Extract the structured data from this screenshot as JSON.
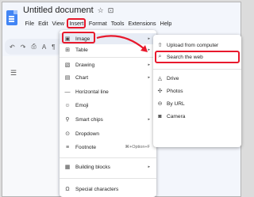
{
  "header": {
    "doc_title": "Untitled document",
    "star_icon": "star-icon",
    "folder_icon": "folder-icon"
  },
  "menubar": [
    "File",
    "Edit",
    "View",
    "Insert",
    "Format",
    "Tools",
    "Extensions",
    "Help"
  ],
  "active_menu": "Insert",
  "toolbar": {
    "undo": "↶",
    "redo": "↷",
    "print": "⎙",
    "spellcheck": "A",
    "paint_format": "¶"
  },
  "insert_menu": {
    "items": [
      {
        "label": "Image",
        "icon": "image-icon",
        "glyph": "▣",
        "has_submenu": true
      },
      {
        "label": "Table",
        "icon": "table-icon",
        "glyph": "⊞",
        "has_submenu": true
      },
      {
        "label": "Drawing",
        "icon": "drawing-icon",
        "glyph": "▧",
        "has_submenu": true
      },
      {
        "label": "Chart",
        "icon": "chart-icon",
        "glyph": "▤",
        "has_submenu": true
      },
      {
        "label": "Horizontal line",
        "icon": "horizontal-line-icon",
        "glyph": "—",
        "has_submenu": false
      },
      {
        "label": "Emoji",
        "icon": "emoji-icon",
        "glyph": "☺",
        "has_submenu": false
      },
      {
        "label": "Smart chips",
        "icon": "smart-chips-icon",
        "glyph": "⚲",
        "has_submenu": true
      },
      {
        "label": "Dropdown",
        "icon": "dropdown-icon",
        "glyph": "⊙",
        "has_submenu": false
      },
      {
        "label": "Footnote",
        "icon": "footnote-icon",
        "glyph": "≡",
        "shortcut": "⌘+Option+F",
        "has_submenu": false
      },
      {
        "label": "Building blocks",
        "icon": "building-blocks-icon",
        "glyph": "▦",
        "has_submenu": true
      },
      {
        "label": "Special characters",
        "icon": "special-characters-icon",
        "glyph": "Ω",
        "has_submenu": false
      }
    ]
  },
  "image_submenu": {
    "items": [
      {
        "label": "Upload from computer",
        "icon": "upload-icon",
        "glyph": "⇧"
      },
      {
        "label": "Search the web",
        "icon": "search-icon",
        "glyph": "⌕"
      },
      {
        "label": "Drive",
        "icon": "drive-icon",
        "glyph": "◬"
      },
      {
        "label": "Photos",
        "icon": "photos-icon",
        "glyph": "✣"
      },
      {
        "label": "By URL",
        "icon": "link-icon",
        "glyph": "⊖"
      },
      {
        "label": "Camera",
        "icon": "camera-icon",
        "glyph": "◙"
      }
    ]
  },
  "colors": {
    "annotation_red": "#e8192c",
    "docs_blue": "#4285f4"
  }
}
